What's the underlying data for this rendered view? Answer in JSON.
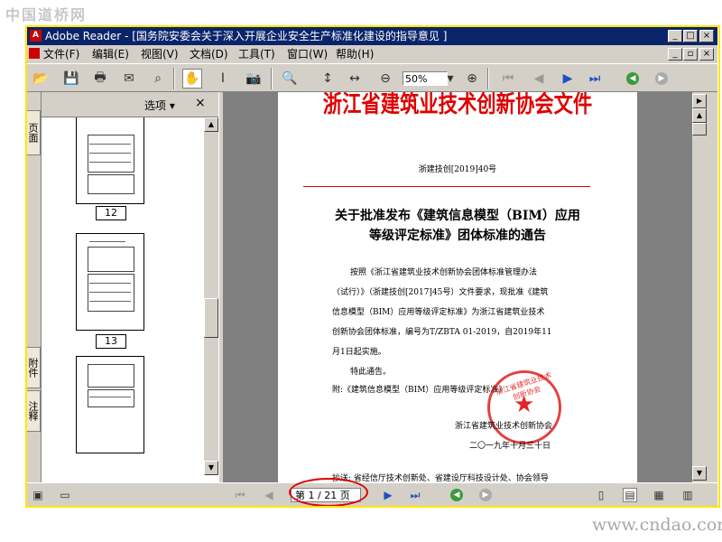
{
  "watermark": {
    "top": "中国道桥网",
    "bottom": "www.cndao.com"
  },
  "window": {
    "title": "Adobe Reader - [国务院安委会关于深入开展企业安全生产标准化建设的指导意见 ]",
    "app_icon_letter": "A"
  },
  "menu": {
    "items": [
      "文件(F)",
      "编辑(E)",
      "视图(V)",
      "文档(D)",
      "工具(T)",
      "窗口(W)",
      "帮助(H)"
    ]
  },
  "toolbar": {
    "zoom": "50%"
  },
  "side_tabs": {
    "pages": "页面",
    "attachments": "附件",
    "comments": "注释"
  },
  "panel": {
    "options_label": "选项 ▾",
    "close": "×"
  },
  "thumbnails": [
    "12",
    "13"
  ],
  "document": {
    "title": "浙江省建筑业技术创新协会文件",
    "number": "浙建技创[2019]40号",
    "notice_line1": "关于批准发布《建筑信息模型（BIM）应用",
    "notice_line2": "等级评定标准》团体标准的通告",
    "para1": "按照《浙江省建筑业技术创新协会团体标准管理办法",
    "para2": "（试行）》（浙建技创[2017]45号）文件要求，现批准《建筑",
    "para3": "信息模型（BIM）应用等级评定标准》为浙江省建筑业技术",
    "para4": "创新协会团体标准，编号为T/ZBTA 01-2019，自2019年11",
    "para5": "月1日起实施。",
    "para6": "特此通告。",
    "attachment": "附:《建筑信息模型（BIM）应用等级评定标准》",
    "issuer": "浙江省建筑业技术创新协会",
    "date": "二〇一九年十月三十日",
    "cc": "抄送: 省经信厅技术创新处、省建设厅科技设计处、协会领导",
    "page_num": "1",
    "stamp_text": "浙江省建筑业技术创新协会"
  },
  "status": {
    "page_indicator": "第 1 / 21 页"
  },
  "colors": {
    "title_red": "#e00000",
    "titlebar": "#0a246a",
    "highlight_ring": "#e00000"
  }
}
